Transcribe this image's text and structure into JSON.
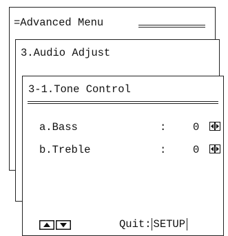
{
  "menus": {
    "advanced_menu": {
      "title": "=Advanced Menu"
    },
    "audio_adjust": {
      "title": "3.Audio Adjust"
    },
    "tone_control": {
      "title": "3-1.Tone Control",
      "rows": [
        {
          "label": "a.Bass",
          "separator": ":",
          "value": "0",
          "icon": "left-right-arrows-icon"
        },
        {
          "label": "b.Treble",
          "separator": ":",
          "value": "0",
          "icon": "left-right-arrows-icon"
        }
      ]
    }
  },
  "footer": {
    "nav_icon": "up-down-arrows-icon",
    "quit_label": "Quit:",
    "setup_key": "SETUP"
  }
}
